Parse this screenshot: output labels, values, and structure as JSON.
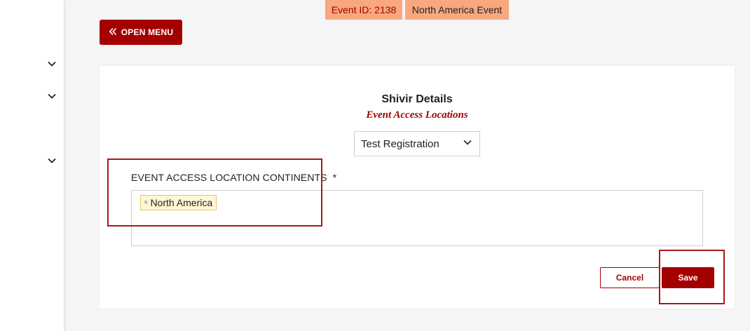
{
  "header": {
    "event_id": "Event ID: 2138",
    "event_name": "North America Event",
    "open_menu_label": "OPEN MENU"
  },
  "card": {
    "title": "Shivir Details",
    "subtitle": "Event Access Locations",
    "select_value": "Test Registration",
    "field_label": "EVENT ACCESS LOCATION CONTINENTS",
    "required_mark": "*",
    "selected_tags": [
      "North America"
    ],
    "cancel_label": "Cancel",
    "save_label": "Save"
  },
  "icons": {
    "sidebar_chevrons": [
      "chevron-down-icon",
      "chevron-down-icon",
      "chevron-down-icon"
    ],
    "open_menu_icon": "double-chevron-left-icon",
    "select_icon": "chevron-down-icon",
    "tag_remove_icon": "close-icon"
  },
  "colors": {
    "primary": "#a50000",
    "badge_bg": "#f9a77f",
    "tag_bg": "#fff7d6",
    "highlight": "#a81818"
  }
}
